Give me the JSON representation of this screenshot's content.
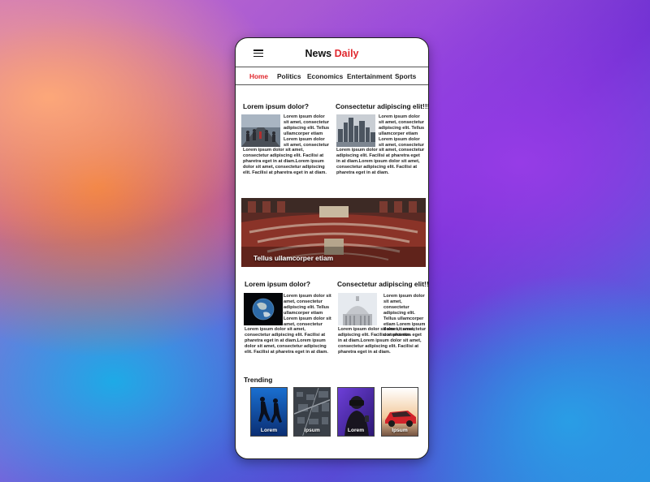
{
  "app": {
    "brand_main": "News",
    "brand_accent": "Daily",
    "accent_color": "#e0282e"
  },
  "nav": {
    "items": [
      {
        "label": "Home",
        "active": true
      },
      {
        "label": "Politics",
        "active": false
      },
      {
        "label": "Economics",
        "active": false
      },
      {
        "label": "Entertainment",
        "active": false
      },
      {
        "label": "Sports",
        "active": false
      }
    ]
  },
  "articles": [
    {
      "headline": "Lorem ipsum dolor?",
      "text_wrap": "Lorem ipsum dolor sit amet, consectetur adipiscing elit. Tellus ullamcorper etiam Lorem ipsum dolor sit amet, consectetur",
      "text_full": "Lorem ipsum dolor sit amet, consectetur adipiscing elit. Facilisi at pharetra eget in at diam.Lorem ipsum dolor sit amet, consectetur adipiscing elit. Facilisi at pharetra eget in at diam.",
      "thumb_icon": "crowd-street-photo"
    },
    {
      "headline": "Consectetur adipiscing elit!!!",
      "text_wrap": "Lorem ipsum dolor sit amet, consectetur adipiscing elit. Tellus ullamcorper etiam Lorem ipsum dolor sit amet, consectetur",
      "text_full": "Lorem ipsum dolor sit amet, consectetur adipiscing elit. Facilisi at pharetra eget in at diam.Lorem ipsum dolor sit amet, consectetur adipiscing elit. Facilisi at pharetra eget in at diam.",
      "thumb_icon": "city-skyline-photo"
    },
    {
      "headline": "Lorem ipsum dolor?",
      "text_wrap": "Lorem ipsum dolor sit amet, consectetur adipiscing elit. Tellus ullamcorper etiam Lorem ipsum dolor sit amet, consectetur",
      "text_full": "Lorem ipsum dolor sit amet, consectetur adipiscing elit. Facilisi at pharetra eget in at diam.Lorem ipsum dolor sit amet, consectetur adipiscing elit. Facilisi at pharetra eget in  at diam.",
      "thumb_icon": "earth-photo"
    },
    {
      "headline": "Consectetur adipiscing elit!!!",
      "text_wrap": "Lorem ipsum dolor sit amet, consectetur adipiscing elit. Tellus ullamcorper etiam Lorem ipsum dolor sit amet, consectetur",
      "text_full": "Lorem ipsum dolor sit amet, consectetur adipiscing elit. Facilisi at pharetra eget in at diam.Lorem ipsum dolor sit amet, consectetur adipiscing elit. Facilisi at pharetra eget in  at diam.",
      "thumb_icon": "capitol-dome-photo"
    }
  ],
  "banner": {
    "caption": "Tellus ullamcorper etiam",
    "icon": "parliament-hall-photo"
  },
  "trending": {
    "title": "Trending",
    "items": [
      {
        "label": "Lorem",
        "icon": "runners-silhouette-photo"
      },
      {
        "label": "ipsum",
        "icon": "city-aerial-photo"
      },
      {
        "label": "Lorem",
        "icon": "vr-headset-photo"
      },
      {
        "label": "Ipsum",
        "icon": "red-sports-car-photo"
      }
    ]
  }
}
